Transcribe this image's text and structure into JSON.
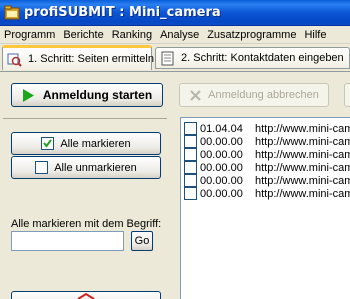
{
  "window": {
    "title": "profiSUBMIT : Mini_camera"
  },
  "menu": [
    "Programm",
    "Berichte",
    "Ranking",
    "Analyse",
    "Zusatzprogramme",
    "Hilfe"
  ],
  "tabs": [
    {
      "label": "1. Schritt: Seiten ermitteln",
      "active": true
    },
    {
      "label": "2. Schritt: Kontaktdaten eingeben",
      "active": false
    }
  ],
  "toolbar": {
    "start_label": "Anmeldung starten",
    "cancel_label": "Anmeldung abbrechen"
  },
  "left": {
    "mark_all": "Alle markieren",
    "unmark_all": "Alle unmarkieren",
    "term_label": "Alle markieren mit dem Begriff:",
    "term_value": "",
    "go_label": "Go"
  },
  "list": {
    "rows": [
      {
        "date": "01.04.04",
        "url": "http://www.mini-cam"
      },
      {
        "date": "00.00.00",
        "url": "http://www.mini-cam"
      },
      {
        "date": "00.00.00",
        "url": "http://www.mini-cam"
      },
      {
        "date": "00.00.00",
        "url": "http://www.mini-cam"
      },
      {
        "date": "00.00.00",
        "url": "http://www.mini-cam"
      },
      {
        "date": "00.00.00",
        "url": "http://www.mini-cam"
      }
    ]
  },
  "colors": {
    "titlebar": "#0b56d6",
    "start_arrow": "#1aa81a",
    "tab_highlight": "#ffc83c"
  }
}
